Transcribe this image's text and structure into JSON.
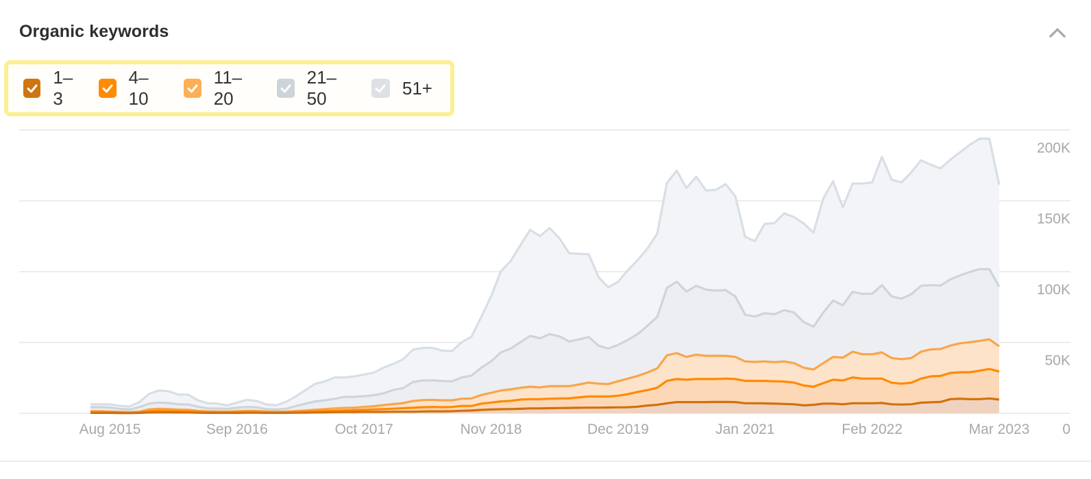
{
  "header": {
    "title": "Organic keywords",
    "collapse_icon": "chevron-up-icon"
  },
  "legend": [
    {
      "label": "1–3",
      "checked": true,
      "color": "#d0740f"
    },
    {
      "label": "4–10",
      "checked": true,
      "color": "#ff8b00"
    },
    {
      "label": "11–20",
      "checked": true,
      "color": "#fdaf55"
    },
    {
      "label": "21–50",
      "checked": true,
      "color": "#ccd3d9"
    },
    {
      "label": "51+",
      "checked": true,
      "color": "#dde1e5"
    }
  ],
  "chart_data": {
    "type": "area",
    "stacked": true,
    "title": "Organic keywords",
    "x_start": "Jun 2015",
    "x_end": "Mar 2023",
    "x_interval": "monthly",
    "x_tick_labels": [
      {
        "index": 2,
        "label": "Aug 2015"
      },
      {
        "index": 15,
        "label": "Sep 2016"
      },
      {
        "index": 28,
        "label": "Oct 2017"
      },
      {
        "index": 41,
        "label": "Nov 2018"
      },
      {
        "index": 54,
        "label": "Dec 2019"
      },
      {
        "index": 67,
        "label": "Jan 2021"
      },
      {
        "index": 80,
        "label": "Feb 2022"
      },
      {
        "index": 93,
        "label": "Mar 2023"
      }
    ],
    "y_tick_labels": [
      {
        "value": 0,
        "label": "0"
      },
      {
        "value": 50,
        "label": "50K"
      },
      {
        "value": 100,
        "label": "100K"
      },
      {
        "value": 150,
        "label": "150K"
      },
      {
        "value": 200,
        "label": "200K"
      }
    ],
    "ylim": [
      0,
      200
    ],
    "y_units": "thousands of keywords",
    "y_axis_position": "right",
    "grid": true,
    "legend_position": "top-left",
    "values_note": "stacked_totals are cumulative top-of-band values read off the chart (in K)",
    "series": [
      {
        "name": "1–3",
        "line_color": "#d2700d",
        "fill_color": "#efd3c0",
        "stacked_totals": [
          0.3,
          0.3,
          0.3,
          0.2,
          0.2,
          0.3,
          0.6,
          0.7,
          0.7,
          0.6,
          0.6,
          0.4,
          0.3,
          0.3,
          0.3,
          0.3,
          0.4,
          0.4,
          0.3,
          0.3,
          0.3,
          0.4,
          0.5,
          0.6,
          0.7,
          0.8,
          0.9,
          0.9,
          1.0,
          1.0,
          1.0,
          1.1,
          1.1,
          1.1,
          1.3,
          1.4,
          1.4,
          1.5,
          1.8,
          2.0,
          2.4,
          2.7,
          2.9,
          3.0,
          3.2,
          3.5,
          3.5,
          3.6,
          3.7,
          3.8,
          3.9,
          4.0,
          4.0,
          4.1,
          4.2,
          4.3,
          4.7,
          5.5,
          6.0,
          7.1,
          7.9,
          7.9,
          7.9,
          7.9,
          8.0,
          8.0,
          7.9,
          7.1,
          7.1,
          7.0,
          6.8,
          6.6,
          6.4,
          5.6,
          6.0,
          6.8,
          6.8,
          6.4,
          7.1,
          7.1,
          7.1,
          7.3,
          6.4,
          6.2,
          6.4,
          7.5,
          7.8,
          8.0,
          10.0,
          10.3,
          10.0,
          10.0,
          10.5,
          9.7
        ]
      },
      {
        "name": "4–10",
        "line_color": "#ff8a00",
        "fill_color": "#fdd8b6",
        "stacked_totals": [
          0.8,
          0.8,
          0.7,
          0.5,
          0.4,
          0.6,
          1.5,
          1.8,
          1.7,
          1.5,
          1.4,
          1.0,
          0.8,
          0.7,
          0.7,
          0.8,
          1.0,
          0.9,
          0.7,
          0.6,
          0.7,
          0.9,
          1.1,
          1.3,
          1.6,
          1.8,
          2.0,
          2.3,
          2.5,
          2.8,
          3.0,
          3.3,
          3.6,
          3.9,
          4.3,
          4.5,
          4.3,
          4.5,
          5.2,
          5.2,
          6.8,
          7.6,
          8.4,
          8.8,
          9.7,
          10.0,
          10.0,
          10.3,
          10.5,
          10.6,
          11.3,
          11.9,
          11.9,
          11.9,
          12.4,
          13.5,
          15.1,
          16.4,
          18.0,
          22.9,
          24.2,
          23.7,
          24.2,
          24.2,
          24.2,
          24.5,
          24.2,
          22.9,
          22.9,
          22.9,
          22.6,
          22.4,
          21.7,
          19.6,
          18.8,
          21.3,
          23.7,
          23.2,
          25.3,
          24.5,
          24.5,
          24.5,
          21.6,
          20.9,
          21.6,
          24.5,
          26.1,
          26.4,
          28.5,
          29.0,
          29.0,
          30.1,
          31.3,
          29.5
        ]
      },
      {
        "name": "11–20",
        "line_color": "#f8a54c",
        "fill_color": "#fde3c9",
        "stacked_totals": [
          1.5,
          1.5,
          1.3,
          1.0,
          0.8,
          1.2,
          2.8,
          3.2,
          3.0,
          2.6,
          2.5,
          1.8,
          1.4,
          1.3,
          1.2,
          1.5,
          1.8,
          1.7,
          1.3,
          1.1,
          1.2,
          1.6,
          2.0,
          2.5,
          3.0,
          3.5,
          3.8,
          4.0,
          4.5,
          5.0,
          5.8,
          6.5,
          7.2,
          8.7,
          9.3,
          9.5,
          9.2,
          9.2,
          10.3,
          10.5,
          12.9,
          14.5,
          16.1,
          16.9,
          18.0,
          18.8,
          18.3,
          19.2,
          19.2,
          19.2,
          20.4,
          21.7,
          20.9,
          20.7,
          22.6,
          24.5,
          26.4,
          28.8,
          31.7,
          40.9,
          42.5,
          39.8,
          41.4,
          40.6,
          40.6,
          40.6,
          39.8,
          36.6,
          36.3,
          36.6,
          36.1,
          36.6,
          35.4,
          32.2,
          30.9,
          35.4,
          39.8,
          39.3,
          43.5,
          41.7,
          41.7,
          43.0,
          39.0,
          38.2,
          39.0,
          43.5,
          45.1,
          45.4,
          47.8,
          49.4,
          50.2,
          51.1,
          52.2,
          47.3
        ]
      },
      {
        "name": "21–50",
        "line_color": "#cdd4dc",
        "fill_color": "#eceef2",
        "stacked_totals": [
          4.3,
          4.3,
          4.0,
          3.2,
          2.7,
          4.3,
          6.8,
          7.6,
          7.3,
          6.4,
          6.3,
          4.7,
          3.5,
          3.4,
          3.2,
          3.9,
          4.5,
          4.2,
          3.0,
          2.7,
          3.2,
          5.1,
          6.8,
          8.4,
          9.2,
          10.3,
          11.6,
          11.6,
          12.1,
          12.8,
          14.1,
          16.5,
          17.8,
          22.1,
          23.2,
          23.3,
          22.8,
          22.5,
          25.3,
          26.6,
          32.2,
          36.6,
          43.0,
          45.7,
          50.2,
          54.7,
          53.0,
          55.9,
          54.3,
          50.7,
          52.2,
          53.8,
          47.8,
          45.7,
          48.3,
          51.8,
          55.9,
          61.8,
          68.0,
          88.6,
          92.9,
          86.0,
          90.0,
          87.3,
          86.6,
          87.0,
          82.5,
          69.6,
          68.3,
          70.7,
          70.0,
          72.8,
          71.2,
          64.4,
          61.2,
          71.2,
          79.6,
          76.3,
          85.7,
          84.4,
          84.4,
          90.5,
          82.5,
          80.9,
          84.1,
          90.0,
          90.5,
          90.2,
          94.5,
          97.4,
          99.8,
          101.8,
          101.8,
          89.4
        ]
      },
      {
        "name": "51+",
        "line_color": "#d8dee5",
        "fill_color": "#f3f4f7",
        "stacked_totals": [
          6.4,
          6.4,
          6.3,
          5.3,
          4.8,
          7.9,
          13.7,
          16.1,
          15.6,
          13.2,
          13.2,
          9.2,
          7.1,
          6.8,
          5.6,
          7.6,
          9.5,
          8.7,
          6.3,
          5.6,
          8.0,
          11.9,
          16.4,
          20.8,
          22.6,
          25.3,
          25.3,
          26.1,
          27.4,
          28.8,
          32.2,
          34.9,
          38.2,
          44.9,
          46.2,
          46.2,
          44.3,
          43.9,
          50.2,
          54.1,
          68.0,
          82.5,
          100.2,
          107.4,
          118.7,
          129.5,
          125.1,
          130.8,
          123.5,
          113.0,
          112.6,
          112.2,
          96.1,
          88.9,
          92.9,
          101.0,
          108.2,
          116.3,
          126.8,
          162.7,
          171.3,
          159.0,
          167.0,
          157.3,
          157.8,
          161.8,
          153.3,
          124.6,
          121.6,
          133.7,
          134.3,
          141.2,
          138.5,
          134.0,
          127.5,
          151.7,
          163.8,
          145.3,
          162.2,
          162.2,
          163.0,
          181.0,
          164.9,
          163.0,
          170.2,
          178.6,
          175.5,
          172.9,
          179.1,
          184.3,
          189.6,
          193.9,
          193.9,
          161.4
        ]
      }
    ]
  }
}
